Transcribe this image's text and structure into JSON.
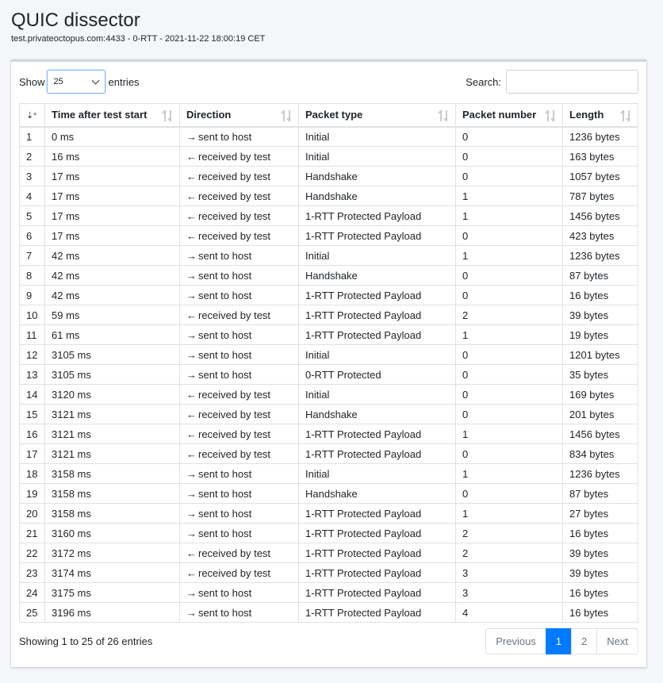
{
  "header": {
    "title": "QUIC dissector",
    "subtitle": "test.privateoctopus.com:4433 - 0-RTT - 2021-11-22 18:00:19 CET"
  },
  "controls": {
    "show_label": "Show",
    "entries_label": "entries",
    "page_length": "25",
    "search_label": "Search:",
    "search_value": ""
  },
  "columns": [
    "",
    "Time after test start",
    "Direction",
    "Packet type",
    "Packet number",
    "Length"
  ],
  "icons": {
    "sent": "arrow-right-icon",
    "received": "arrow-left-icon"
  },
  "rows": [
    [
      "1",
      "0 ms",
      "sent to host",
      "Initial",
      "0",
      "1236 bytes"
    ],
    [
      "2",
      "16 ms",
      "received by test",
      "Initial",
      "0",
      "163 bytes"
    ],
    [
      "3",
      "17 ms",
      "received by test",
      "Handshake",
      "0",
      "1057 bytes"
    ],
    [
      "4",
      "17 ms",
      "received by test",
      "Handshake",
      "1",
      "787 bytes"
    ],
    [
      "5",
      "17 ms",
      "received by test",
      "1-RTT Protected Payload",
      "1",
      "1456 bytes"
    ],
    [
      "6",
      "17 ms",
      "received by test",
      "1-RTT Protected Payload",
      "0",
      "423 bytes"
    ],
    [
      "7",
      "42 ms",
      "sent to host",
      "Initial",
      "1",
      "1236 bytes"
    ],
    [
      "8",
      "42 ms",
      "sent to host",
      "Handshake",
      "0",
      "87 bytes"
    ],
    [
      "9",
      "42 ms",
      "sent to host",
      "1-RTT Protected Payload",
      "0",
      "16 bytes"
    ],
    [
      "10",
      "59 ms",
      "received by test",
      "1-RTT Protected Payload",
      "2",
      "39 bytes"
    ],
    [
      "11",
      "61 ms",
      "sent to host",
      "1-RTT Protected Payload",
      "1",
      "19 bytes"
    ],
    [
      "12",
      "3105 ms",
      "sent to host",
      "Initial",
      "0",
      "1201 bytes"
    ],
    [
      "13",
      "3105 ms",
      "sent to host",
      "0-RTT Protected",
      "0",
      "35 bytes"
    ],
    [
      "14",
      "3120 ms",
      "received by test",
      "Initial",
      "0",
      "169 bytes"
    ],
    [
      "15",
      "3121 ms",
      "received by test",
      "Handshake",
      "0",
      "201 bytes"
    ],
    [
      "16",
      "3121 ms",
      "received by test",
      "1-RTT Protected Payload",
      "1",
      "1456 bytes"
    ],
    [
      "17",
      "3121 ms",
      "received by test",
      "1-RTT Protected Payload",
      "0",
      "834 bytes"
    ],
    [
      "18",
      "3158 ms",
      "sent to host",
      "Initial",
      "1",
      "1236 bytes"
    ],
    [
      "19",
      "3158 ms",
      "sent to host",
      "Handshake",
      "0",
      "87 bytes"
    ],
    [
      "20",
      "3158 ms",
      "sent to host",
      "1-RTT Protected Payload",
      "1",
      "27 bytes"
    ],
    [
      "21",
      "3160 ms",
      "sent to host",
      "1-RTT Protected Payload",
      "2",
      "16 bytes"
    ],
    [
      "22",
      "3172 ms",
      "received by test",
      "1-RTT Protected Payload",
      "2",
      "39 bytes"
    ],
    [
      "23",
      "3174 ms",
      "received by test",
      "1-RTT Protected Payload",
      "3",
      "39 bytes"
    ],
    [
      "24",
      "3175 ms",
      "sent to host",
      "1-RTT Protected Payload",
      "3",
      "16 bytes"
    ],
    [
      "25",
      "3196 ms",
      "sent to host",
      "1-RTT Protected Payload",
      "4",
      "16 bytes"
    ]
  ],
  "footer": {
    "info": "Showing 1 to 25 of 26 entries",
    "previous": "Previous",
    "pages": [
      "1",
      "2"
    ],
    "next": "Next",
    "active_page": "1"
  },
  "colors": {
    "accent": "#007bff",
    "background": "#f4f6f9"
  }
}
